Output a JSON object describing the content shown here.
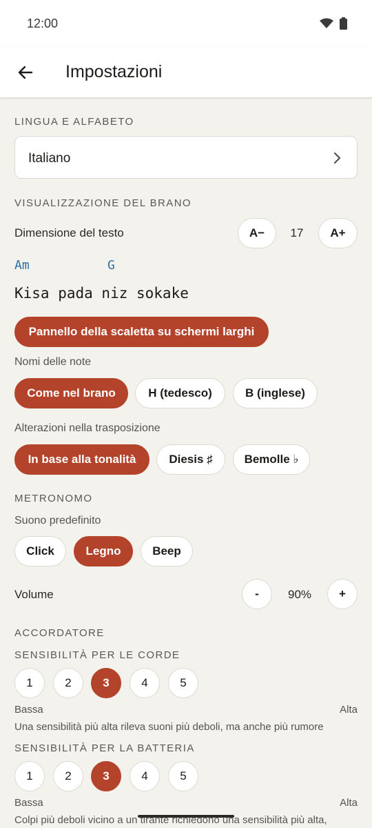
{
  "status": {
    "time": "12:00"
  },
  "app_bar": {
    "title": "Impostazioni"
  },
  "language": {
    "section": "LINGUA E ALFABETO",
    "value": "Italiano"
  },
  "display": {
    "section": "VISUALIZZAZIONE DEL BRANO",
    "text_size_label": "Dimensione del testo",
    "decrease_label": "A−",
    "size_value": "17",
    "increase_label": "A+",
    "preview": {
      "chord_1": "Am",
      "chord_2": "G",
      "lyric": "Kisa pada niz sokake"
    },
    "setlist_panel_label": "Pannello della scaletta su schermi larghi",
    "note_names_label": "Nomi delle note",
    "note_names": [
      "Come nel brano",
      "H (tedesco)",
      "B (inglese)"
    ],
    "accidentals_label": "Alterazioni nella trasposizione",
    "accidentals": [
      "In base alla tonalità",
      "Diesis ♯",
      "Bemolle ♭"
    ]
  },
  "metronome": {
    "section": "METRONOMO",
    "sound_label": "Suono predefinito",
    "sounds": [
      "Click",
      "Legno",
      "Beep"
    ],
    "volume_label": "Volume",
    "volume_minus": "-",
    "volume_value": "90%",
    "volume_plus": "+"
  },
  "tuner": {
    "section": "ACCORDATORE",
    "strings_label": "SENSIBILITÀ PER LE CORDE",
    "strings_levels": [
      "1",
      "2",
      "3",
      "4",
      "5"
    ],
    "strings_selected": "3",
    "low_label": "Bassa",
    "high_label": "Alta",
    "strings_hint": "Una sensibilità più alta rileva suoni più deboli, ma anche più rumore",
    "drums_label": "SENSIBILITÀ PER LA BATTERIA",
    "drums_levels": [
      "1",
      "2",
      "3",
      "4",
      "5"
    ],
    "drums_selected": "3",
    "drums_low_label": "Bassa",
    "drums_high_label": "Alta",
    "drums_hint": "Colpi più deboli vicino a un tirante richiedono una sensibilità più alta,"
  },
  "colors": {
    "accent": "#b4432b",
    "chord": "#2a6fa8",
    "background": "#f4f2ec"
  }
}
